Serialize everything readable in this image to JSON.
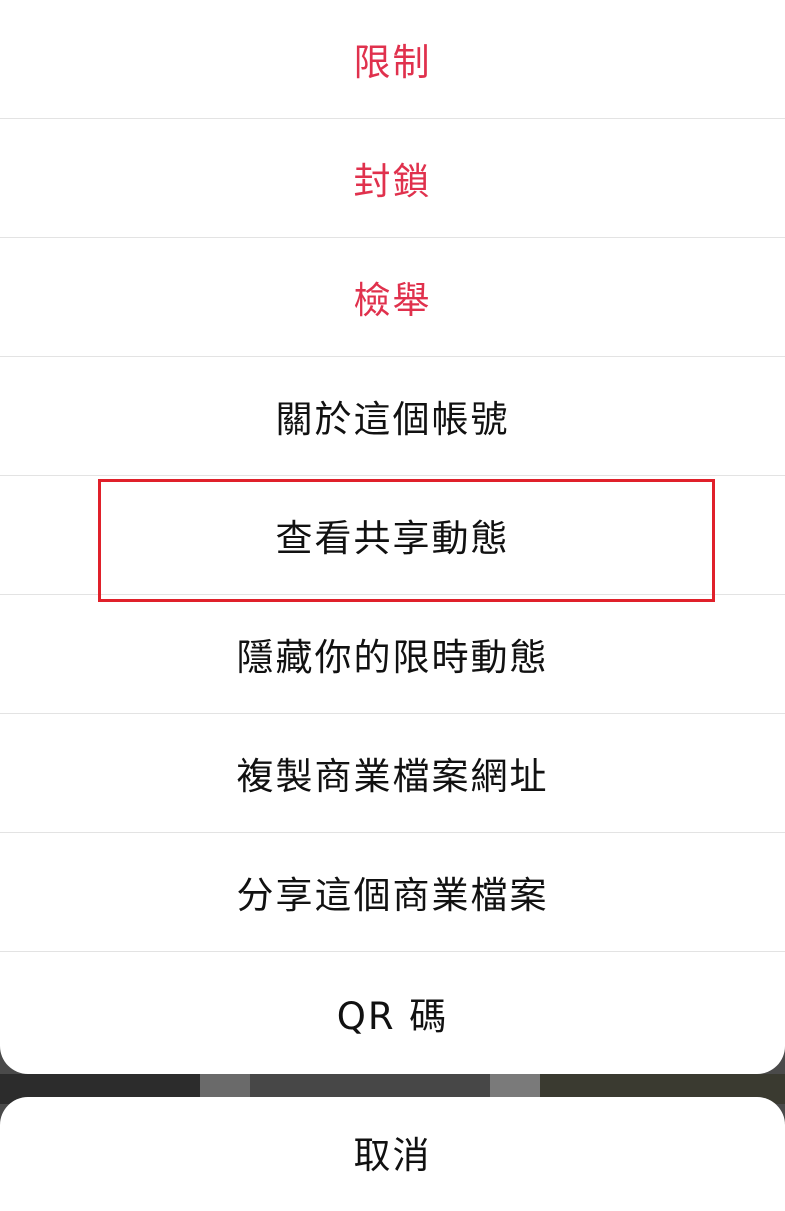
{
  "menu": {
    "items": [
      {
        "label": "限制",
        "destructive": true
      },
      {
        "label": "封鎖",
        "destructive": true
      },
      {
        "label": "檢舉",
        "destructive": true
      },
      {
        "label": "關於這個帳號",
        "destructive": false
      },
      {
        "label": "查看共享動態",
        "destructive": false,
        "highlighted": true
      },
      {
        "label": "隱藏你的限時動態",
        "destructive": false
      },
      {
        "label": "複製商業檔案網址",
        "destructive": false
      },
      {
        "label": "分享這個商業檔案",
        "destructive": false
      },
      {
        "label": "QR 碼",
        "destructive": false
      }
    ]
  },
  "cancel": {
    "label": "取消"
  },
  "colors": {
    "destructive": "#e0314d",
    "highlight_border": "#e0202a",
    "text": "#111111"
  }
}
